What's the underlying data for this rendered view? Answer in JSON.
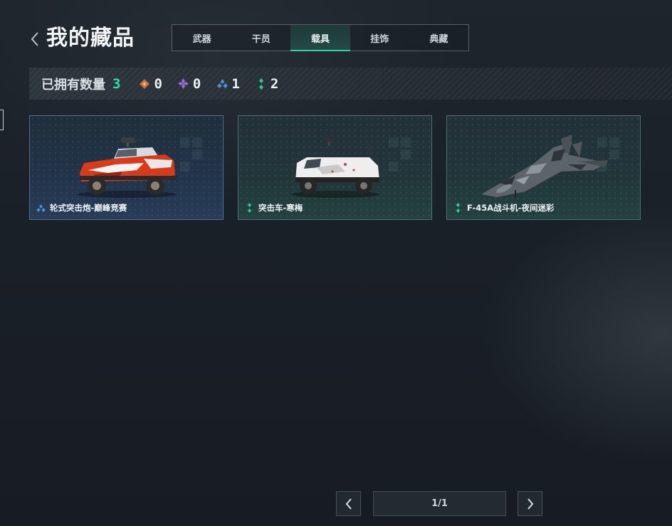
{
  "header": {
    "title": "我的藏品"
  },
  "tabs": [
    {
      "label": "武器",
      "active": false
    },
    {
      "label": "干员",
      "active": false
    },
    {
      "label": "载具",
      "active": true
    },
    {
      "label": "挂饰",
      "active": false
    },
    {
      "label": "典藏",
      "active": false
    }
  ],
  "stats": {
    "owned_label": "已拥有数量",
    "owned_count": "3",
    "rarities": [
      {
        "icon": "orange-diamond-icon",
        "color": "#c9703a",
        "count": "0"
      },
      {
        "icon": "purple-diamond-icon",
        "color": "#9a6ae0",
        "count": "0"
      },
      {
        "icon": "blue-diamond-icon",
        "color": "#4f8fd6",
        "count": "1"
      },
      {
        "icon": "green-diamond-icon",
        "color": "#2ec88f",
        "count": "2"
      }
    ]
  },
  "items": [
    {
      "name": "轮式突击炮-巅峰竞赛",
      "rarity_icon": "blue-diamond-icon",
      "rarity_color": "#4f8fd6",
      "image": "red-armored-car"
    },
    {
      "name": "突击车-寒梅",
      "rarity_icon": "green-diamond-icon",
      "rarity_color": "#2ec88f",
      "image": "white-assault-vehicle"
    },
    {
      "name": "F-45A战斗机-夜间迷彩",
      "rarity_icon": "green-diamond-icon",
      "rarity_color": "#2ec88f",
      "image": "camo-fighter-jet"
    }
  ],
  "pagination": {
    "label": "1/1"
  },
  "colors": {
    "accent": "#2fd3a4",
    "owned_count": "#2fe0a6"
  }
}
